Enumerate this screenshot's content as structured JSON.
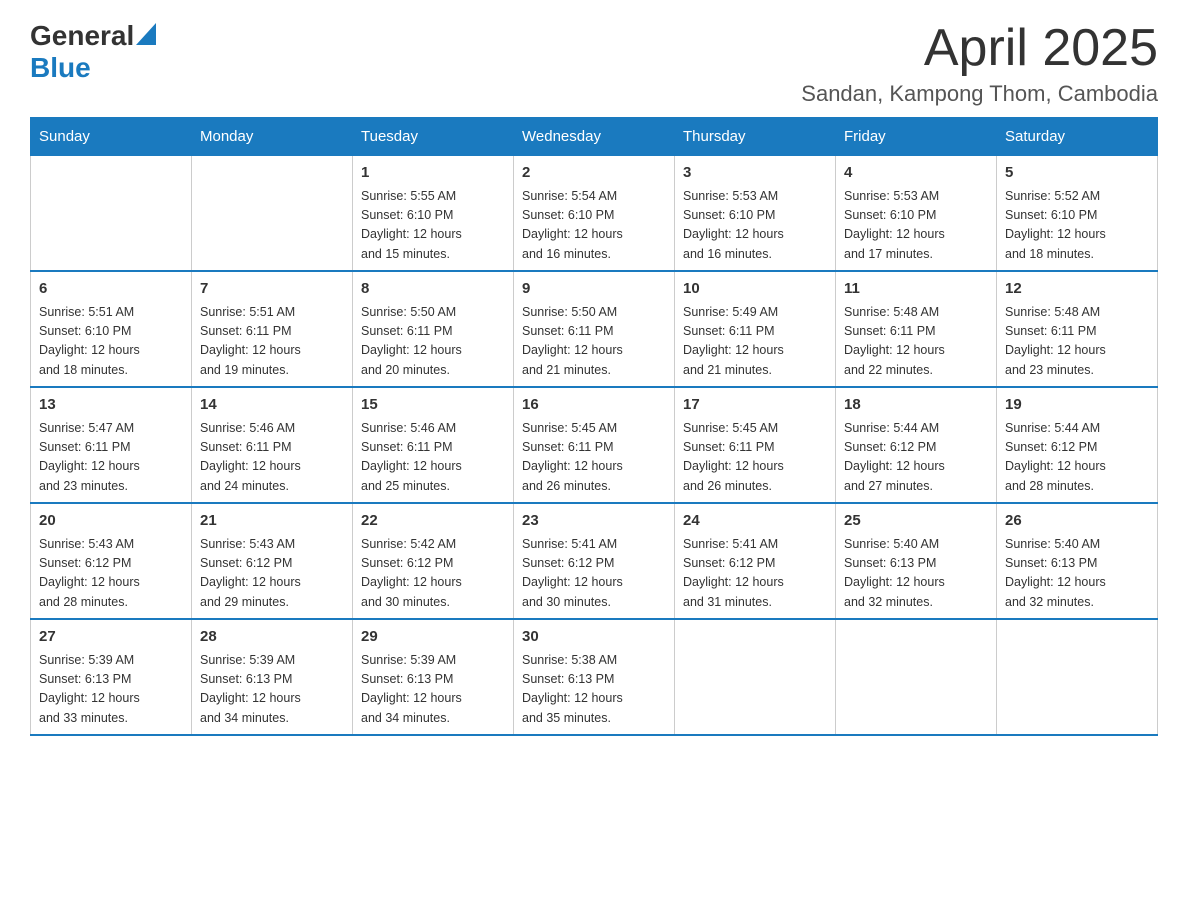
{
  "logo": {
    "general": "General",
    "blue": "Blue"
  },
  "title": "April 2025",
  "subtitle": "Sandan, Kampong Thom, Cambodia",
  "days_of_week": [
    "Sunday",
    "Monday",
    "Tuesday",
    "Wednesday",
    "Thursday",
    "Friday",
    "Saturday"
  ],
  "weeks": [
    [
      {
        "day": "",
        "info": ""
      },
      {
        "day": "",
        "info": ""
      },
      {
        "day": "1",
        "info": "Sunrise: 5:55 AM\nSunset: 6:10 PM\nDaylight: 12 hours\nand 15 minutes."
      },
      {
        "day": "2",
        "info": "Sunrise: 5:54 AM\nSunset: 6:10 PM\nDaylight: 12 hours\nand 16 minutes."
      },
      {
        "day": "3",
        "info": "Sunrise: 5:53 AM\nSunset: 6:10 PM\nDaylight: 12 hours\nand 16 minutes."
      },
      {
        "day": "4",
        "info": "Sunrise: 5:53 AM\nSunset: 6:10 PM\nDaylight: 12 hours\nand 17 minutes."
      },
      {
        "day": "5",
        "info": "Sunrise: 5:52 AM\nSunset: 6:10 PM\nDaylight: 12 hours\nand 18 minutes."
      }
    ],
    [
      {
        "day": "6",
        "info": "Sunrise: 5:51 AM\nSunset: 6:10 PM\nDaylight: 12 hours\nand 18 minutes."
      },
      {
        "day": "7",
        "info": "Sunrise: 5:51 AM\nSunset: 6:11 PM\nDaylight: 12 hours\nand 19 minutes."
      },
      {
        "day": "8",
        "info": "Sunrise: 5:50 AM\nSunset: 6:11 PM\nDaylight: 12 hours\nand 20 minutes."
      },
      {
        "day": "9",
        "info": "Sunrise: 5:50 AM\nSunset: 6:11 PM\nDaylight: 12 hours\nand 21 minutes."
      },
      {
        "day": "10",
        "info": "Sunrise: 5:49 AM\nSunset: 6:11 PM\nDaylight: 12 hours\nand 21 minutes."
      },
      {
        "day": "11",
        "info": "Sunrise: 5:48 AM\nSunset: 6:11 PM\nDaylight: 12 hours\nand 22 minutes."
      },
      {
        "day": "12",
        "info": "Sunrise: 5:48 AM\nSunset: 6:11 PM\nDaylight: 12 hours\nand 23 minutes."
      }
    ],
    [
      {
        "day": "13",
        "info": "Sunrise: 5:47 AM\nSunset: 6:11 PM\nDaylight: 12 hours\nand 23 minutes."
      },
      {
        "day": "14",
        "info": "Sunrise: 5:46 AM\nSunset: 6:11 PM\nDaylight: 12 hours\nand 24 minutes."
      },
      {
        "day": "15",
        "info": "Sunrise: 5:46 AM\nSunset: 6:11 PM\nDaylight: 12 hours\nand 25 minutes."
      },
      {
        "day": "16",
        "info": "Sunrise: 5:45 AM\nSunset: 6:11 PM\nDaylight: 12 hours\nand 26 minutes."
      },
      {
        "day": "17",
        "info": "Sunrise: 5:45 AM\nSunset: 6:11 PM\nDaylight: 12 hours\nand 26 minutes."
      },
      {
        "day": "18",
        "info": "Sunrise: 5:44 AM\nSunset: 6:12 PM\nDaylight: 12 hours\nand 27 minutes."
      },
      {
        "day": "19",
        "info": "Sunrise: 5:44 AM\nSunset: 6:12 PM\nDaylight: 12 hours\nand 28 minutes."
      }
    ],
    [
      {
        "day": "20",
        "info": "Sunrise: 5:43 AM\nSunset: 6:12 PM\nDaylight: 12 hours\nand 28 minutes."
      },
      {
        "day": "21",
        "info": "Sunrise: 5:43 AM\nSunset: 6:12 PM\nDaylight: 12 hours\nand 29 minutes."
      },
      {
        "day": "22",
        "info": "Sunrise: 5:42 AM\nSunset: 6:12 PM\nDaylight: 12 hours\nand 30 minutes."
      },
      {
        "day": "23",
        "info": "Sunrise: 5:41 AM\nSunset: 6:12 PM\nDaylight: 12 hours\nand 30 minutes."
      },
      {
        "day": "24",
        "info": "Sunrise: 5:41 AM\nSunset: 6:12 PM\nDaylight: 12 hours\nand 31 minutes."
      },
      {
        "day": "25",
        "info": "Sunrise: 5:40 AM\nSunset: 6:13 PM\nDaylight: 12 hours\nand 32 minutes."
      },
      {
        "day": "26",
        "info": "Sunrise: 5:40 AM\nSunset: 6:13 PM\nDaylight: 12 hours\nand 32 minutes."
      }
    ],
    [
      {
        "day": "27",
        "info": "Sunrise: 5:39 AM\nSunset: 6:13 PM\nDaylight: 12 hours\nand 33 minutes."
      },
      {
        "day": "28",
        "info": "Sunrise: 5:39 AM\nSunset: 6:13 PM\nDaylight: 12 hours\nand 34 minutes."
      },
      {
        "day": "29",
        "info": "Sunrise: 5:39 AM\nSunset: 6:13 PM\nDaylight: 12 hours\nand 34 minutes."
      },
      {
        "day": "30",
        "info": "Sunrise: 5:38 AM\nSunset: 6:13 PM\nDaylight: 12 hours\nand 35 minutes."
      },
      {
        "day": "",
        "info": ""
      },
      {
        "day": "",
        "info": ""
      },
      {
        "day": "",
        "info": ""
      }
    ]
  ],
  "colors": {
    "header_bg": "#1a7abf",
    "header_text": "#ffffff",
    "border": "#cccccc",
    "row_border": "#1a7abf"
  }
}
